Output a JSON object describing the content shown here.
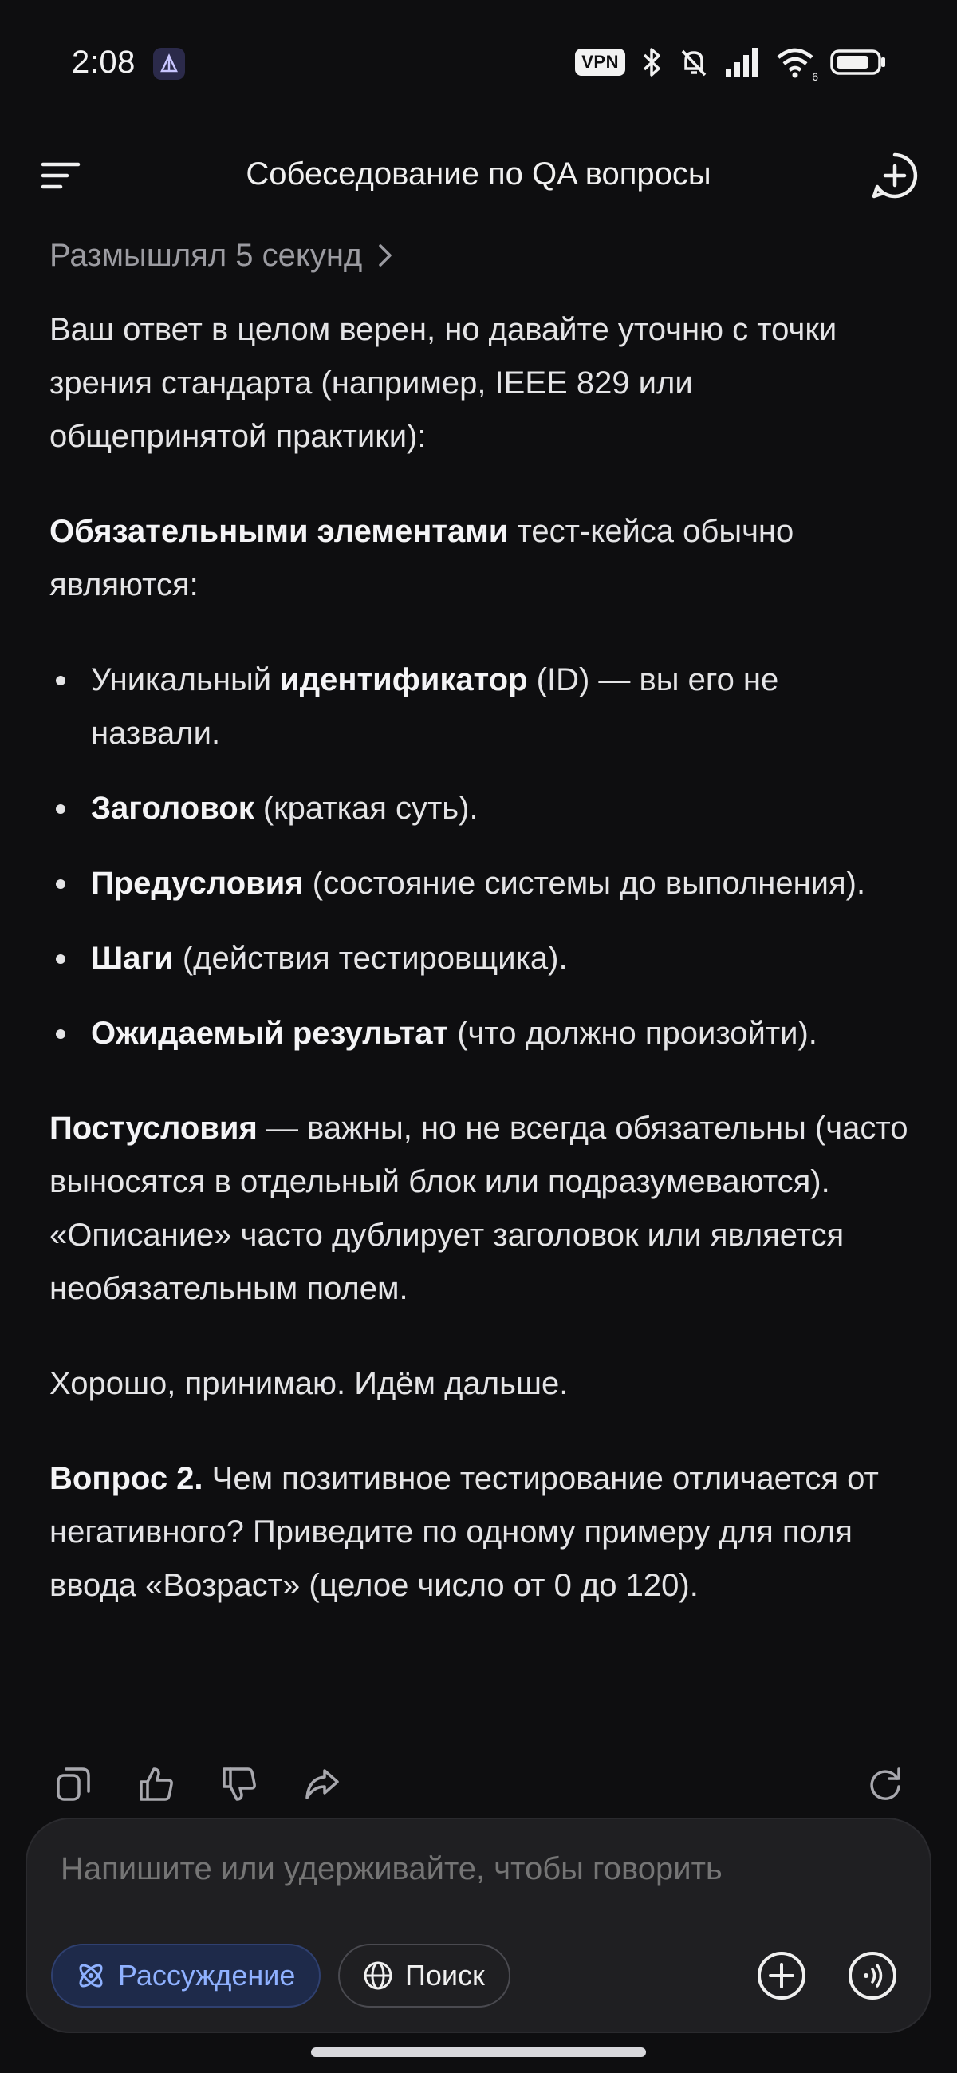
{
  "status": {
    "time": "2:08",
    "vpn": "VPN",
    "wifi_sub": "6"
  },
  "header": {
    "title": "Собеседование по QA вопросы"
  },
  "message": {
    "thinking": "Размышлял 5 секунд",
    "intro": "Ваш ответ в целом верен, но давайте уточню с точки зрения стандарта (например, IEEE 829 или общепринятой практики):",
    "mandatory_bold": "Обязательными элементами",
    "mandatory_rest": " тест-кейса обычно являются:",
    "items": [
      {
        "pre": "Уникальный ",
        "bold": "идентификатор",
        "post": " (ID) — вы его не назвали."
      },
      {
        "pre": "",
        "bold": "Заголовок",
        "post": " (краткая суть)."
      },
      {
        "pre": "",
        "bold": "Предусловия",
        "post": " (состояние системы до выполнения)."
      },
      {
        "pre": "",
        "bold": "Шаги",
        "post": " (действия тестировщика)."
      },
      {
        "pre": "",
        "bold": "Ожидаемый результат",
        "post": " (что должно произойти)."
      }
    ],
    "post_bold": "Постусловия",
    "post_rest": " — важны, но не всегда обязательны (часто выносятся в отдельный блок или подразумеваются). «Описание» часто дублирует заголовок или является необязательным полем.",
    "accept": "Хорошо, принимаю. Идём дальше.",
    "question_bold": "Вопрос 2.",
    "question_rest": " Чем позитивное тестирование отличается от негативного? Приведите по одному примеру для поля ввода «Возраст» (целое число от 0 до 120)."
  },
  "composer": {
    "placeholder": "Напишите или удерживайте, чтобы говорить",
    "reasoning_label": "Рассуждение",
    "search_label": "Поиск"
  },
  "colors": {
    "background": "#0e0e10",
    "accent": "#8fb1ff",
    "composer": "#1f1f22"
  }
}
